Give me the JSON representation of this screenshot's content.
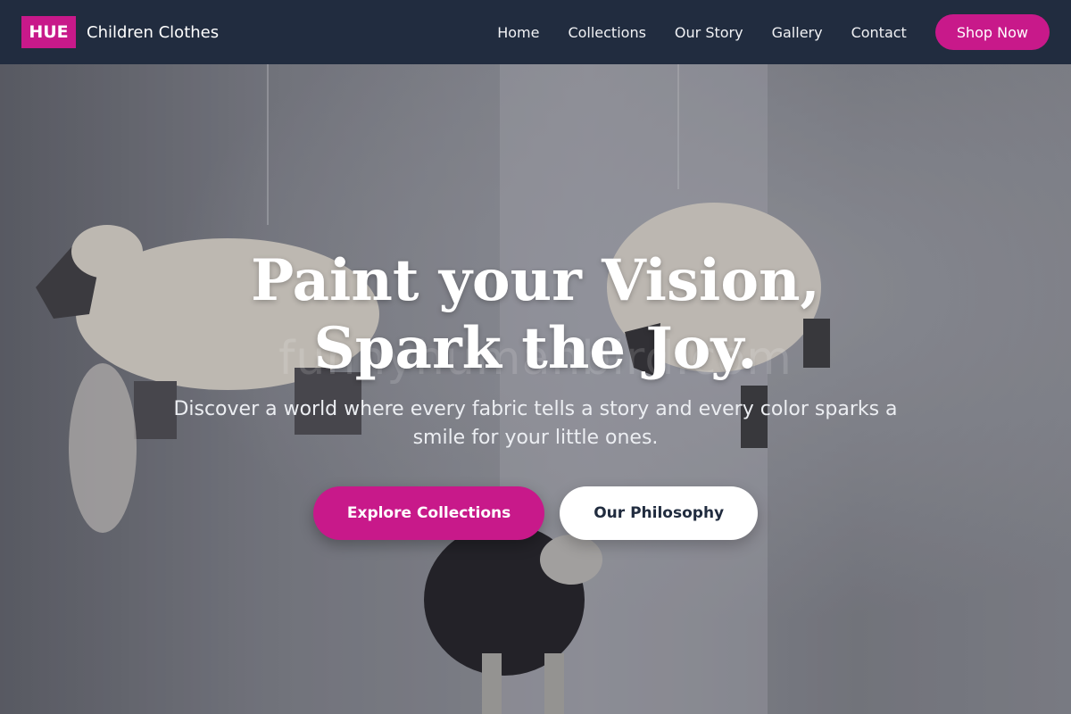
{
  "brand": {
    "logo": "HUE",
    "name": "Children Clothes"
  },
  "nav": {
    "links": [
      "Home",
      "Collections",
      "Our Story",
      "Gallery",
      "Contact"
    ],
    "cta": "Shop Now"
  },
  "hero": {
    "title": "Paint your Vision, Spark the Joy.",
    "subtitle": "Discover a world where every fabric tells a story and every color sparks a smile for your little ones.",
    "watermark": "funnyhumanbird.com",
    "primary_button": "Explore Collections",
    "secondary_button": "Our Philosophy",
    "background_image": "felt-sheep-mobile"
  },
  "colors": {
    "accent": "#c8198a",
    "nav_bg": "#212c3f",
    "white": "#ffffff"
  }
}
